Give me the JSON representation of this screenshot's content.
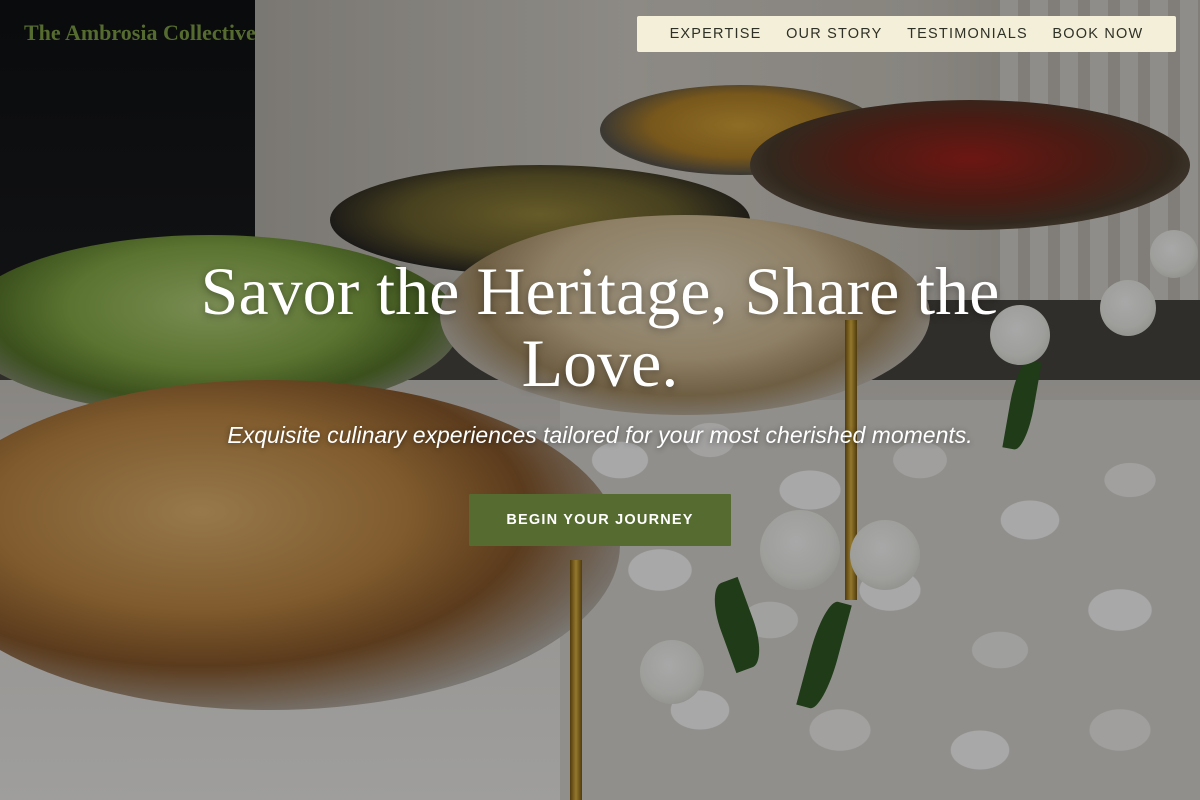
{
  "header": {
    "brand_name": "The Ambrosia Collective",
    "nav": {
      "items": [
        {
          "label": "EXPERTISE"
        },
        {
          "label": "OUR STORY"
        },
        {
          "label": "TESTIMONIALS"
        },
        {
          "label": "BOOK NOW"
        }
      ]
    }
  },
  "hero": {
    "title": "Savor the Heritage, Share the Love.",
    "subtitle": "Exquisite culinary experiences tailored for your most cherished moments.",
    "cta_label": "BEGIN YOUR JOURNEY",
    "background_image": "catering-buffet-photo"
  },
  "colors": {
    "brand_green": "#556b2f",
    "nav_background": "#f3efd9",
    "nav_text": "#2f3126",
    "hero_text": "#ffffff"
  }
}
